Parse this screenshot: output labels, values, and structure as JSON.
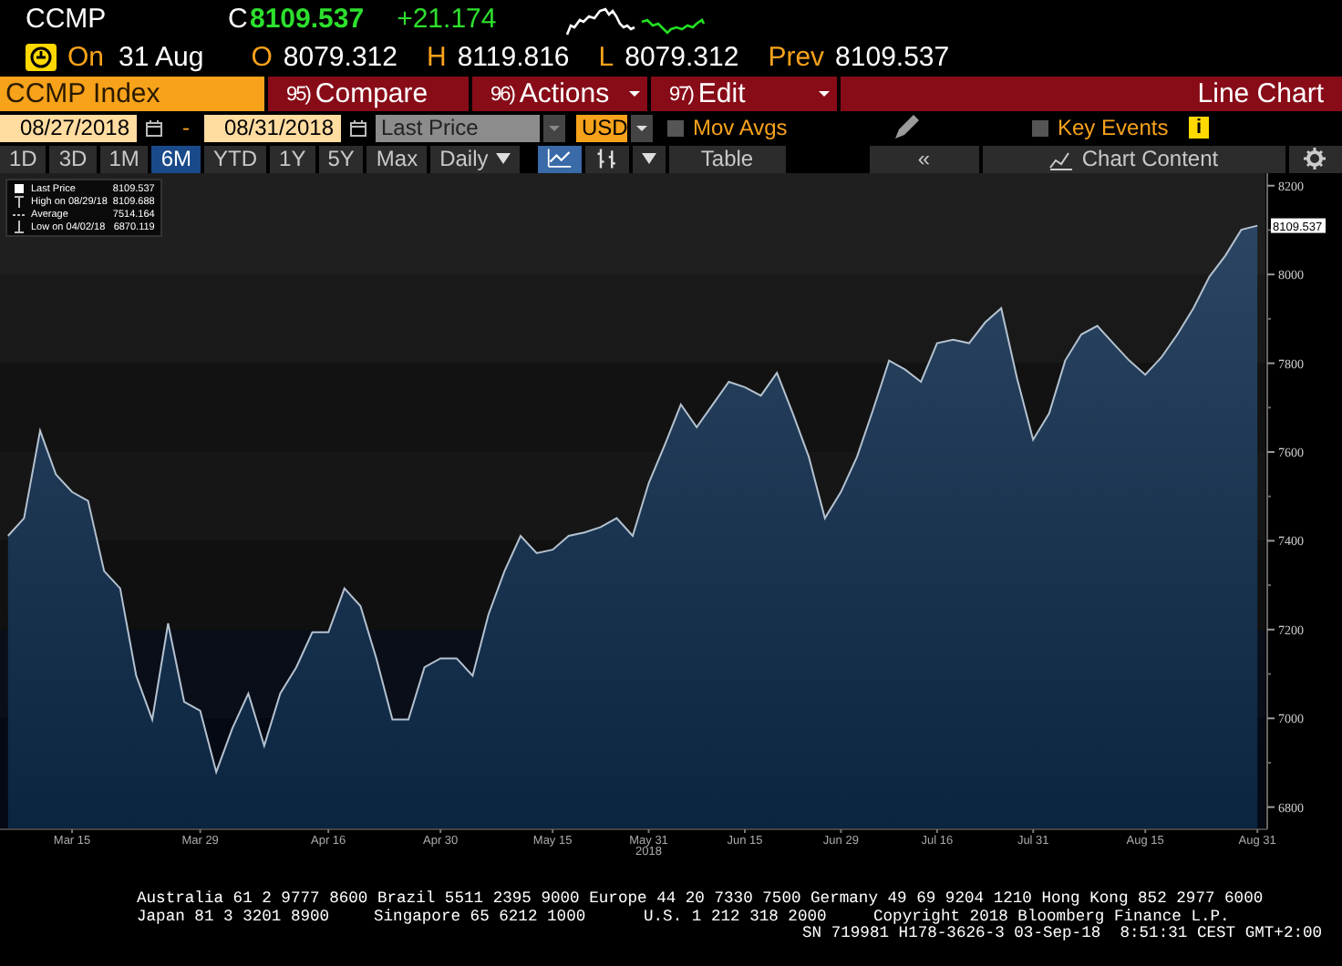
{
  "header": {
    "ticker": "CCMP",
    "close_label": "C",
    "last": "8109.537",
    "change": "+21.174"
  },
  "quote": {
    "date_label": "On",
    "date": "31 Aug",
    "fields": [
      {
        "label": "O",
        "value": "8079.312"
      },
      {
        "label": "H",
        "value": "8119.816"
      },
      {
        "label": "L",
        "value": "8079.312"
      },
      {
        "label": "Prev",
        "value": "8109.537"
      }
    ]
  },
  "menu": {
    "security": "CCMP Index",
    "buttons": [
      {
        "number": "95)",
        "label": "Compare",
        "dropdown": false
      },
      {
        "number": "96)",
        "label": "Actions",
        "dropdown": true
      },
      {
        "number": "97)",
        "label": "Edit",
        "dropdown": true
      }
    ],
    "view": "Line Chart"
  },
  "controls": {
    "start_date": "08/27/2018",
    "separator": "-",
    "end_date": "08/31/2018",
    "field": "Last Price",
    "currency": "USD",
    "options": [
      {
        "label": "Mov Avgs",
        "checked": false
      },
      {
        "label": "Key Events",
        "checked": false
      }
    ],
    "info": "i"
  },
  "toolbar": {
    "periods": [
      {
        "label": "1D",
        "selected": false
      },
      {
        "label": "3D",
        "selected": false
      },
      {
        "label": "1M",
        "selected": false
      },
      {
        "label": "6M",
        "selected": true
      },
      {
        "label": "YTD",
        "selected": false
      },
      {
        "label": "1Y",
        "selected": false
      },
      {
        "label": "5Y",
        "selected": false
      },
      {
        "label": "Max",
        "selected": false
      }
    ],
    "frequency": "Daily",
    "chart_types": [
      {
        "kind": "line",
        "selected": true
      },
      {
        "kind": "bars",
        "selected": false
      }
    ],
    "table": "Table",
    "collapse": "«",
    "chart_content": "Chart Content"
  },
  "chart": {
    "legend": [
      {
        "kind": "last",
        "value": "8109.537"
      },
      {
        "kind": "high",
        "label": "High on 08/29/18",
        "value": "8109.688"
      },
      {
        "kind": "average",
        "label": "Average",
        "value": "7514.164"
      },
      {
        "kind": "low",
        "label": "Low on 04/02/18",
        "value": "6870.119"
      }
    ],
    "last_tag": "8109.537",
    "year_label": "2018",
    "chart_data": {
      "type": "area",
      "categories": [
        null,
        null,
        null,
        null,
        "Mar 15",
        null,
        null,
        null,
        null,
        null,
        null,
        null,
        "Mar 29",
        null,
        null,
        null,
        null,
        null,
        null,
        null,
        "Apr 16",
        null,
        null,
        null,
        null,
        null,
        null,
        "Apr 30",
        null,
        null,
        null,
        null,
        null,
        null,
        "May 15",
        null,
        null,
        null,
        null,
        null,
        "May 31",
        null,
        null,
        null,
        null,
        null,
        "Jun 15",
        null,
        null,
        null,
        null,
        null,
        "Jun 29",
        null,
        null,
        null,
        null,
        null,
        "Jul 16",
        null,
        null,
        null,
        null,
        null,
        "Jul 31",
        null,
        null,
        null,
        null,
        null,
        null,
        "Aug 15",
        null,
        null,
        null,
        null,
        null,
        null,
        "Aug 31"
      ],
      "series": [
        {
          "name": "Last Price",
          "color": "#b4c2d0",
          "values": [
            7411,
            7451,
            7648,
            7549,
            7510,
            7490,
            7332,
            7293,
            7096,
            6997,
            7214,
            7037,
            7017,
            6879,
            6977,
            7056,
            6938,
            7056,
            7115,
            7194,
            7194,
            7293,
            7253,
            7135,
            6997,
            6997,
            7115,
            7135,
            7135,
            7096,
            7234,
            7332,
            7411,
            7372,
            7380,
            7411,
            7419,
            7431,
            7451,
            7411,
            7530,
            7616,
            7707,
            7656,
            7707,
            7758,
            7746,
            7727,
            7778,
            7687,
            7589,
            7451,
            7510,
            7589,
            7695,
            7806,
            7786,
            7758,
            7845,
            7853,
            7845,
            7892,
            7924,
            7766,
            7628,
            7687,
            7806,
            7865,
            7884,
            7845,
            7806,
            7774,
            7813,
            7865,
            7924,
            7995,
            8042,
            8101,
            8110
          ]
        }
      ],
      "ylim": [
        6750,
        8220
      ],
      "yticks": [
        6800,
        7000,
        7200,
        7400,
        7600,
        7800,
        8000,
        8200
      ]
    }
  },
  "footer": {
    "lines": [
      [
        "Australia 61 2 9777 8600 Brazil 5511 2395 9000 Europe 44 20 7330 7500 Germany 49 69 9204 1210 Hong Kong 852 2977 6000"
      ],
      [
        "Japan 81 3 3201 8900",
        "Singapore 65 6212 1000",
        "U.S. 1 212 318 2000",
        "Copyright 2018 Bloomberg Finance L.P."
      ],
      [
        "SN 719981 H178-3626-3 03-Sep-18  8:51:31 CEST GMT+2:00"
      ]
    ]
  }
}
